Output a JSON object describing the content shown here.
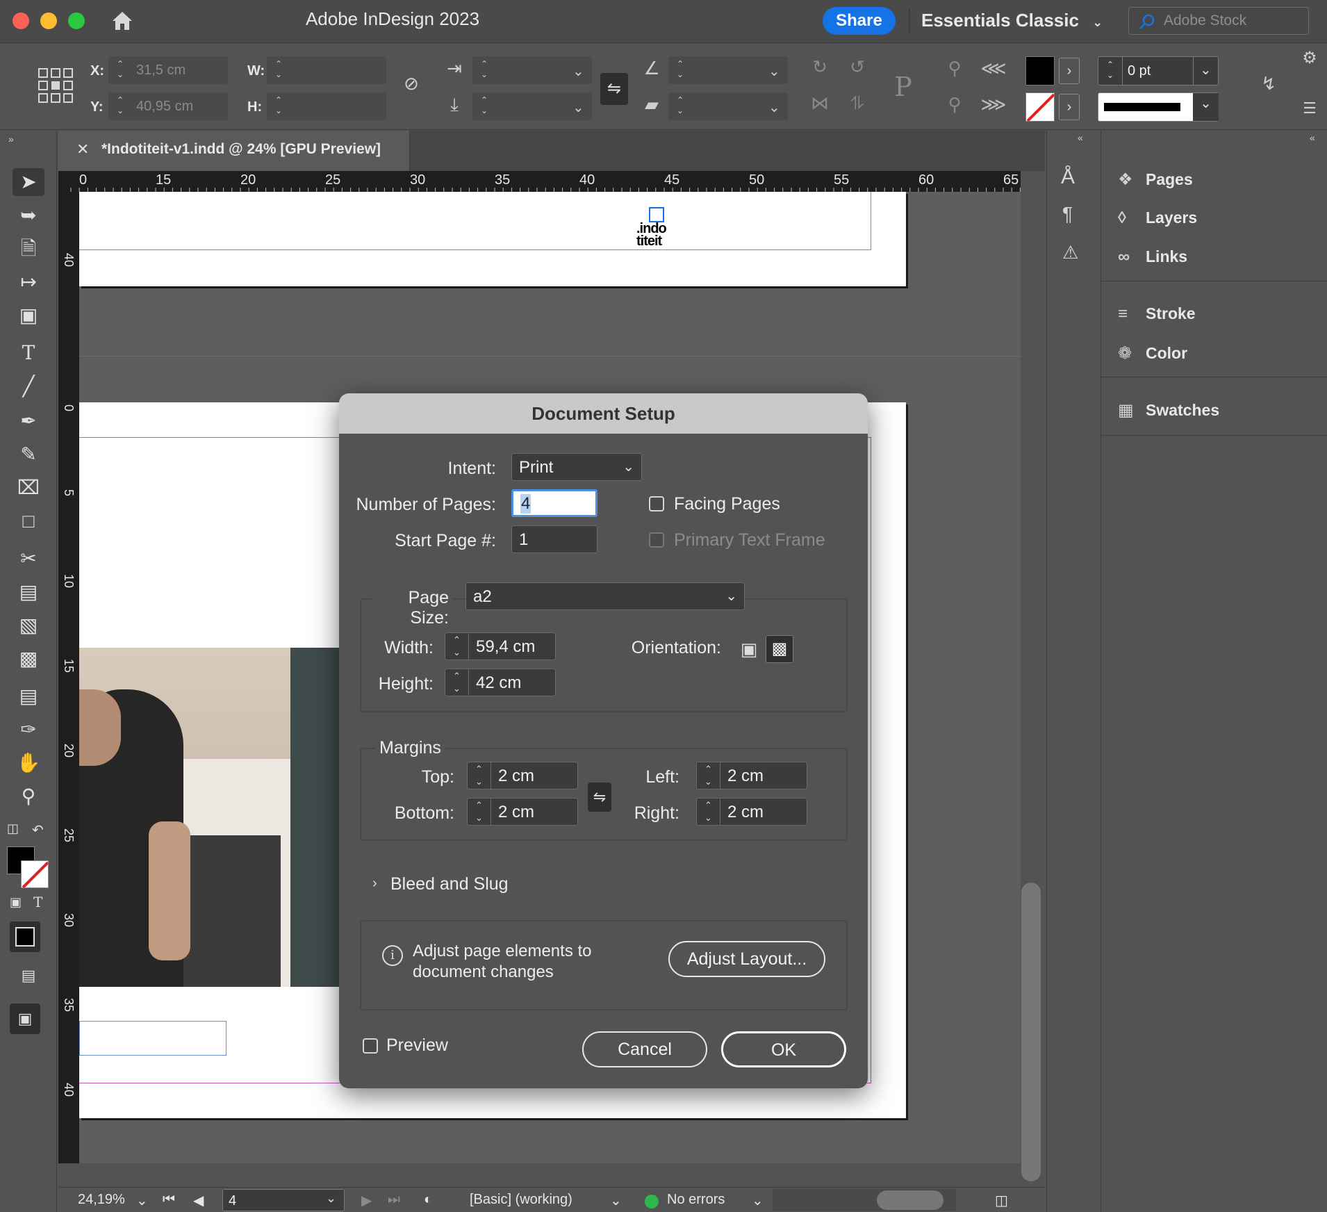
{
  "titlebar": {
    "app_title": "Adobe InDesign 2023",
    "share_label": "Share",
    "workspace_label": "Essentials Classic",
    "stock_placeholder": "Adobe Stock",
    "traffic_colors": [
      "#fe5f57",
      "#febc2e",
      "#28c840"
    ]
  },
  "controlbar": {
    "x_label": "X:",
    "x_value": "31,5 cm",
    "y_label": "Y:",
    "y_value": "40,95 cm",
    "w_label": "W:",
    "h_label": "H:",
    "stroke_weight": "0 pt"
  },
  "document": {
    "tab_title": "*Indotiteit-v1.indd @ 24% [GPU Preview]",
    "logo_line1": ".indo",
    "logo_line2": "titeit",
    "ruler_h_ticks": [
      "0",
      "15",
      "20",
      "25",
      "30",
      "35",
      "40",
      "45",
      "50",
      "55",
      "60",
      "65"
    ],
    "ruler_v_ticks": [
      "40",
      "0",
      "5",
      "10",
      "15",
      "20",
      "25",
      "30",
      "35",
      "40"
    ]
  },
  "panels": {
    "items": [
      {
        "label": "Pages",
        "icon": "pages-icon"
      },
      {
        "label": "Layers",
        "icon": "layers-icon"
      },
      {
        "label": "Links",
        "icon": "links-icon"
      },
      {
        "label": "Stroke",
        "icon": "stroke-icon"
      },
      {
        "label": "Color",
        "icon": "color-icon"
      },
      {
        "label": "Swatches",
        "icon": "swatches-icon"
      }
    ]
  },
  "statusbar": {
    "zoom": "24,19%",
    "page": "4",
    "preflight_profile": "[Basic] (working)",
    "errors": "No errors",
    "status_color": "#2db84d"
  },
  "dialog": {
    "title": "Document Setup",
    "intent_label": "Intent:",
    "intent_value": "Print",
    "num_pages_label": "Number of Pages:",
    "num_pages_value": "4",
    "start_page_label": "Start Page #:",
    "start_page_value": "1",
    "facing_pages_label": "Facing Pages",
    "facing_pages_checked": false,
    "primary_text_frame_label": "Primary Text Frame",
    "primary_text_frame_checked": false,
    "page_size_label": "Page Size:",
    "page_size_value": "a2",
    "width_label": "Width:",
    "width_value": "59,4 cm",
    "height_label": "Height:",
    "height_value": "42 cm",
    "orientation_label": "Orientation:",
    "orientation_selected": "landscape",
    "margins_label": "Margins",
    "top_label": "Top:",
    "top_value": "2 cm",
    "bottom_label": "Bottom:",
    "bottom_value": "2 cm",
    "left_label": "Left:",
    "left_value": "2 cm",
    "right_label": "Right:",
    "right_value": "2 cm",
    "bleed_label": "Bleed and Slug",
    "adjust_text": "Adjust page elements to document changes",
    "adjust_button": "Adjust Layout...",
    "preview_label": "Preview",
    "preview_checked": false,
    "cancel_label": "Cancel",
    "ok_label": "OK"
  }
}
